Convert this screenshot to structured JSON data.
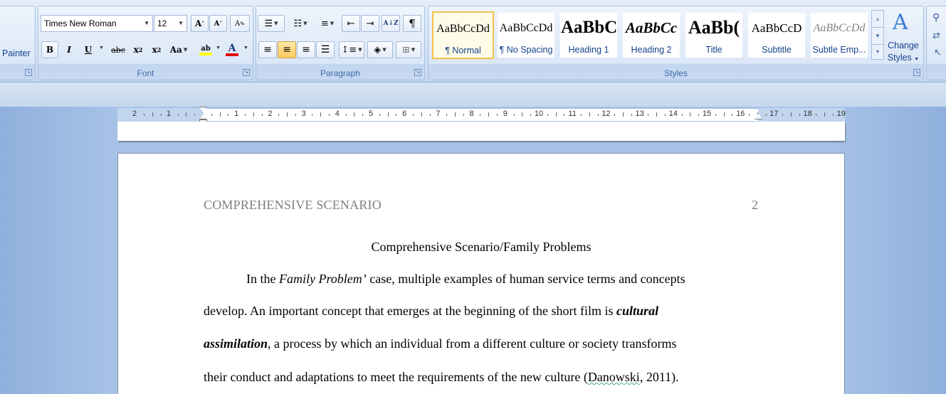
{
  "clipboard": {
    "painter_label": "Painter"
  },
  "font": {
    "group_label": "Font",
    "font_name": "Times New Roman",
    "font_size": "12",
    "grow_label": "A",
    "shrink_label": "A",
    "clear_label": "A",
    "bold": "B",
    "italic": "I",
    "underline": "U",
    "strike": "abc",
    "subscript": "x",
    "subscript_mark": "2",
    "superscript": "x",
    "superscript_mark": "2",
    "change_case": "Aa",
    "highlight_label": "ab",
    "font_color_label": "A",
    "highlight_color": "#ffff00",
    "font_color": "#e00000"
  },
  "paragraph": {
    "group_label": "Paragraph",
    "sort_label": "A↓Z",
    "pilcrow": "¶"
  },
  "styles": {
    "group_label": "Styles",
    "tiles": [
      {
        "sample": "AaBbCcDd",
        "name": "¶ Normal"
      },
      {
        "sample": "AaBbCcDd",
        "name": "¶ No Spacing"
      },
      {
        "sample": "AaBbC",
        "name": "Heading 1"
      },
      {
        "sample": "AaBbCc",
        "name": "Heading 2"
      },
      {
        "sample": "AaBb(",
        "name": "Title"
      },
      {
        "sample": "AaBbCcD",
        "name": "Subtitle"
      },
      {
        "sample": "AaBbCcDd",
        "name": "Subtle Emp..."
      }
    ],
    "change_styles_line1": "Change",
    "change_styles_line2": "Styles",
    "accent": "#f2c14e"
  },
  "ruler": {
    "left_numbers": [
      "2",
      "1"
    ],
    "numbers": [
      "1",
      "2",
      "3",
      "4",
      "5",
      "6",
      "7",
      "8",
      "9",
      "10",
      "11",
      "12",
      "13",
      "14",
      "15",
      "16",
      "17",
      "18",
      "19"
    ]
  },
  "document": {
    "header_text": "COMPREHENSIVE SCENARIO",
    "page_number": "2",
    "title": "Comprehensive Scenario/Family Problems",
    "l1_a": "In the ",
    "l1_italic": "Family Problem’",
    "l1_b": " case, multiple examples of human service terms and concepts",
    "l2_a": "develop. An important concept that emerges at the beginning of the short film is ",
    "l2_bi": "cultural",
    "l3_bi": "assimilation",
    "l3_b": ", a process by which an individual from a different culture or society transforms",
    "l4_a": "their conduct and adaptations to meet the requirements of the new culture (",
    "l4_name": "Danowski",
    "l4_b": ", 2011)."
  }
}
